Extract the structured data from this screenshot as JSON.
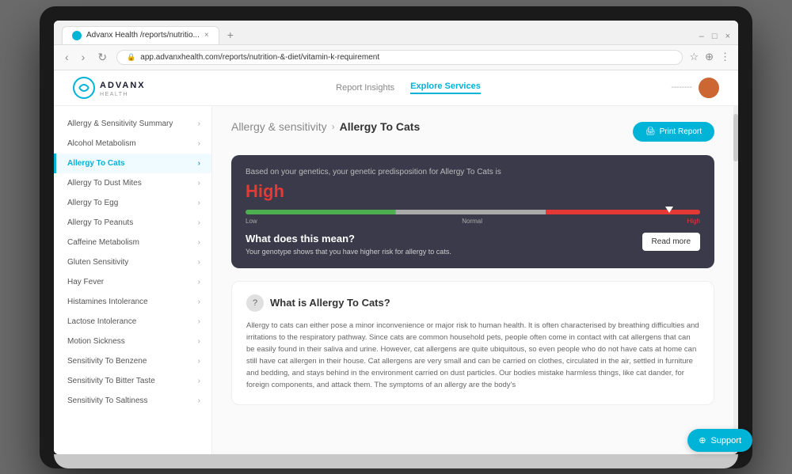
{
  "browser": {
    "tab_title": "Advanx Health /reports/nutritio...",
    "new_tab_label": "+",
    "address": "app.advanxhealth.com/reports/nutrition-&-diet/vitamin-k-requirement",
    "window_controls": {
      "minimize": "–",
      "maximize": "□",
      "close": "×"
    }
  },
  "header": {
    "logo_name": "ADVANX",
    "logo_sub": "HEALTH",
    "nav": [
      {
        "label": "Report Insights",
        "active": false
      },
      {
        "label": "Explore Services",
        "active": true
      }
    ],
    "user_name": "--------",
    "print_label": "Print Report"
  },
  "breadcrumb": {
    "parent": "Allergy & sensitivity",
    "separator": "›",
    "current": "Allergy To Cats"
  },
  "sidebar": {
    "items": [
      {
        "label": "Allergy & Sensitivity Summary",
        "active": false
      },
      {
        "label": "Alcohol Metabolism",
        "active": false
      },
      {
        "label": "Allergy To Cats",
        "active": true
      },
      {
        "label": "Allergy To Dust Mites",
        "active": false
      },
      {
        "label": "Allergy To Egg",
        "active": false
      },
      {
        "label": "Allergy To Peanuts",
        "active": false
      },
      {
        "label": "Caffeine Metabolism",
        "active": false
      },
      {
        "label": "Gluten Sensitivity",
        "active": false
      },
      {
        "label": "Hay Fever",
        "active": false
      },
      {
        "label": "Histamines Intolerance",
        "active": false
      },
      {
        "label": "Lactose Intolerance",
        "active": false
      },
      {
        "label": "Motion Sickness",
        "active": false
      },
      {
        "label": "Sensitivity To Benzene",
        "active": false
      },
      {
        "label": "Sensitivity To Bitter Taste",
        "active": false
      },
      {
        "label": "Sensitivity To Saltiness",
        "active": false
      }
    ]
  },
  "risk_card": {
    "subtitle": "Based on your genetics, your genetic predisposition for Allergy To Cats is",
    "level": "High",
    "labels": {
      "low": "Low",
      "normal": "Normal",
      "high": "High"
    },
    "what_means_title": "What does this mean?",
    "genotype_text": "Your genotype shows that you have higher risk for allergy to cats.",
    "read_more_label": "Read more"
  },
  "info_section": {
    "title": "What is Allergy To Cats?",
    "text": "Allergy to cats can either pose a minor inconvenience or major risk to human health. It is often characterised by breathing difficulties and irritations to the respiratory pathway. Since cats are common household pets, people often come in contact with cat allergens that can be easily found in their saliva and urine. However, cat allergens are quite ubiquitous, so even people who do not have cats at home can still have cat allergen in their house. Cat allergens are very small and can be carried on clothes, circulated in the air, settled in furniture and bedding, and stays behind in the environment carried on dust particles. Our bodies mistake harmless things, like cat dander, for foreign components, and attack them. The symptoms of an allergy are the body's"
  },
  "support": {
    "label": "Support"
  }
}
